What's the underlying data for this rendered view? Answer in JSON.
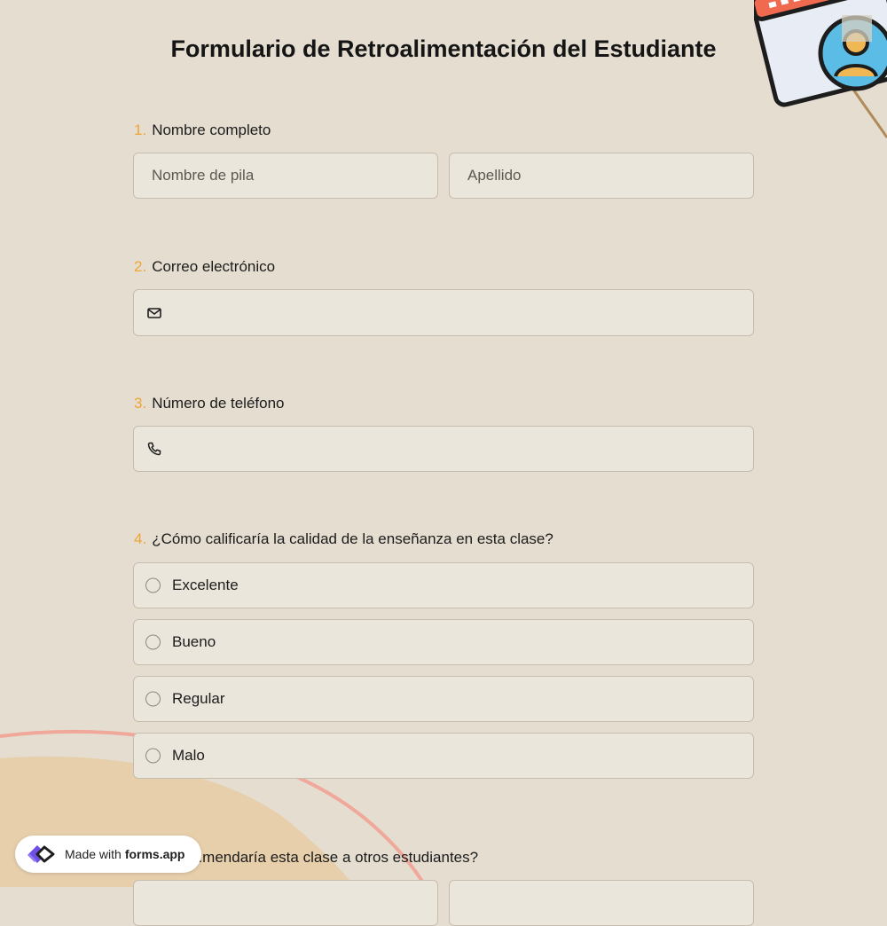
{
  "form": {
    "title": "Formulario de Retroalimentación del Estudiante",
    "questions": [
      {
        "number": "1.",
        "label": "Nombre completo",
        "fields": [
          {
            "placeholder": "Nombre de pila",
            "value": ""
          },
          {
            "placeholder": "Apellido",
            "value": ""
          }
        ]
      },
      {
        "number": "2.",
        "label": "Correo electrónico",
        "icon": "envelope-icon",
        "value": ""
      },
      {
        "number": "3.",
        "label": "Número de teléfono",
        "icon": "phone-icon",
        "value": ""
      },
      {
        "number": "4.",
        "label": "¿Cómo calificaría la calidad de la enseñanza en esta clase?",
        "options": [
          "Excelente",
          "Bueno",
          "Regular",
          "Malo"
        ],
        "selected": null
      },
      {
        "label_visible": "...mendaría esta clase a otros estudiantes?"
      }
    ]
  },
  "badge": {
    "made_with": "Made with",
    "brand": "forms.app",
    "icon": "forms-app-logo-icon"
  },
  "colors": {
    "background": "#e4ddd0",
    "accent_number": "#eea534",
    "field_background": "#ebe6dc",
    "field_border": "#c7bdae",
    "decor_peach": "#e7cfac",
    "decor_arc": "#f0a89a",
    "illustration_red": "#f06a4f",
    "illustration_blue": "#5bbce6",
    "illustration_yellow": "#f1b754"
  },
  "decor": {
    "corner_illustration": "user-profile-window-icon"
  }
}
